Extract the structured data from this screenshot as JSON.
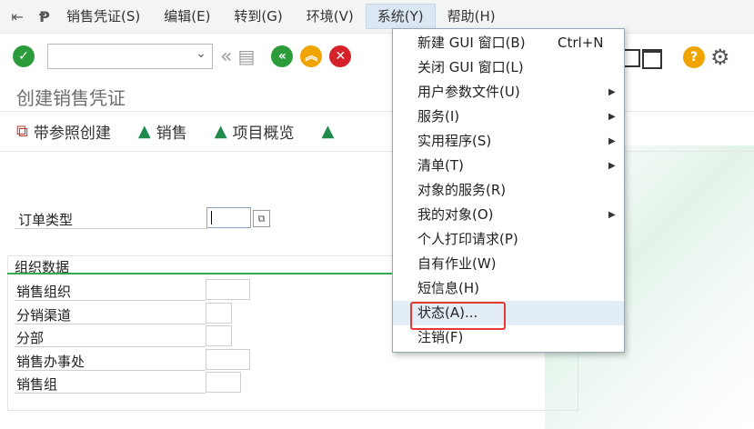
{
  "menubar": {
    "items": [
      "销售凭证(S)",
      "编辑(E)",
      "转到(G)",
      "环境(V)",
      "系统(Y)",
      "帮助(H)"
    ]
  },
  "title": "创建销售凭证",
  "app_toolbar": [
    "带参照创建",
    "销售",
    "项目概览"
  ],
  "form": {
    "order_type_label": "订单类型",
    "group_title": "组织数据",
    "fields": [
      "销售组织",
      "分销渠道",
      "分部",
      "销售办事处",
      "销售组"
    ]
  },
  "menu": {
    "items": [
      {
        "label": "新建 GUI 窗口(B)",
        "shortcut": "Ctrl+N",
        "submenu": false
      },
      {
        "label": "关闭 GUI 窗口(L)",
        "shortcut": "",
        "submenu": false
      },
      {
        "label": "用户参数文件(U)",
        "shortcut": "",
        "submenu": true
      },
      {
        "label": "服务(I)",
        "shortcut": "",
        "submenu": true
      },
      {
        "label": "实用程序(S)",
        "shortcut": "",
        "submenu": true
      },
      {
        "label": "清单(T)",
        "shortcut": "",
        "submenu": true
      },
      {
        "label": "对象的服务(R)",
        "shortcut": "",
        "submenu": false
      },
      {
        "label": "我的对象(O)",
        "shortcut": "",
        "submenu": true
      },
      {
        "label": "个人打印请求(P)",
        "shortcut": "",
        "submenu": false
      },
      {
        "label": "自有作业(W)",
        "shortcut": "",
        "submenu": false
      },
      {
        "label": "短信息(H)",
        "shortcut": "",
        "submenu": false
      },
      {
        "label": "状态(A)...",
        "shortcut": "",
        "submenu": false
      },
      {
        "label": "注销(F)",
        "shortcut": "",
        "submenu": false
      }
    ]
  },
  "colors": {
    "accent_green": "#34a853",
    "highlight_red": "#e53935",
    "menu_highlight": "#e3edf6"
  }
}
